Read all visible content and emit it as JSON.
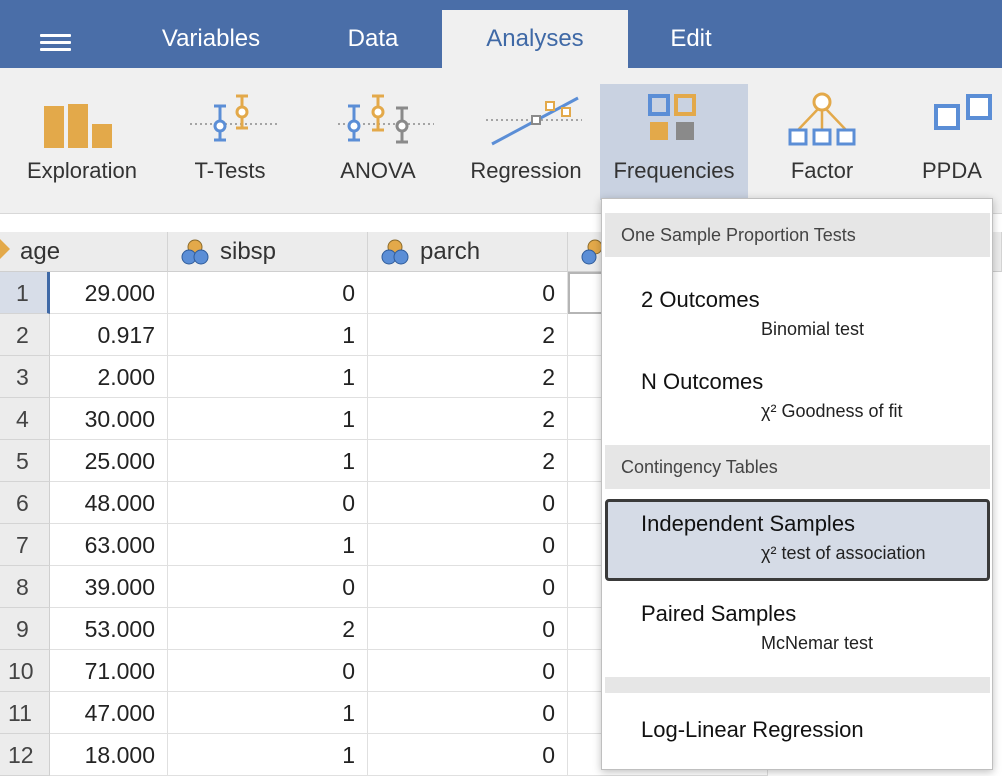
{
  "menu_button": "hamburger-menu",
  "tabs": [
    "Variables",
    "Data",
    "Analyses",
    "Edit"
  ],
  "active_tab": "Analyses",
  "ribbon": [
    "Exploration",
    "T-Tests",
    "ANOVA",
    "Regression",
    "Frequencies",
    "Factor",
    "PPDA"
  ],
  "active_ribbon": "Frequencies",
  "columns": [
    "age",
    "sibsp",
    "parch"
  ],
  "rows": [
    {
      "n": "1",
      "age": "29.000",
      "sibsp": "0",
      "parch": "0"
    },
    {
      "n": "2",
      "age": "0.917",
      "sibsp": "1",
      "parch": "2"
    },
    {
      "n": "3",
      "age": "2.000",
      "sibsp": "1",
      "parch": "2"
    },
    {
      "n": "4",
      "age": "30.000",
      "sibsp": "1",
      "parch": "2"
    },
    {
      "n": "5",
      "age": "25.000",
      "sibsp": "1",
      "parch": "2"
    },
    {
      "n": "6",
      "age": "48.000",
      "sibsp": "0",
      "parch": "0"
    },
    {
      "n": "7",
      "age": "63.000",
      "sibsp": "1",
      "parch": "0"
    },
    {
      "n": "8",
      "age": "39.000",
      "sibsp": "0",
      "parch": "0"
    },
    {
      "n": "9",
      "age": "53.000",
      "sibsp": "2",
      "parch": "0"
    },
    {
      "n": "10",
      "age": "71.000",
      "sibsp": "0",
      "parch": "0"
    },
    {
      "n": "11",
      "age": "47.000",
      "sibsp": "1",
      "parch": "0"
    },
    {
      "n": "12",
      "age": "18.000",
      "sibsp": "1",
      "parch": "0"
    }
  ],
  "menu": {
    "group1": "One Sample Proportion Tests",
    "outcomes2_title": "2 Outcomes",
    "outcomes2_sub": "Binomial test",
    "outcomesN_title": "N Outcomes",
    "outcomesN_sub": "χ² Goodness of fit",
    "group2": "Contingency Tables",
    "indep_title": "Independent Samples",
    "indep_sub": "χ² test of association",
    "paired_title": "Paired Samples",
    "paired_sub": "McNemar test",
    "loglinear": "Log-Linear Regression"
  },
  "colors": {
    "topbar": "#4a6ea8",
    "accent": "#3f69a6",
    "icon_gold": "#e3a94a",
    "icon_blue": "#5b8ed6",
    "icon_grey": "#8a8a8a"
  }
}
